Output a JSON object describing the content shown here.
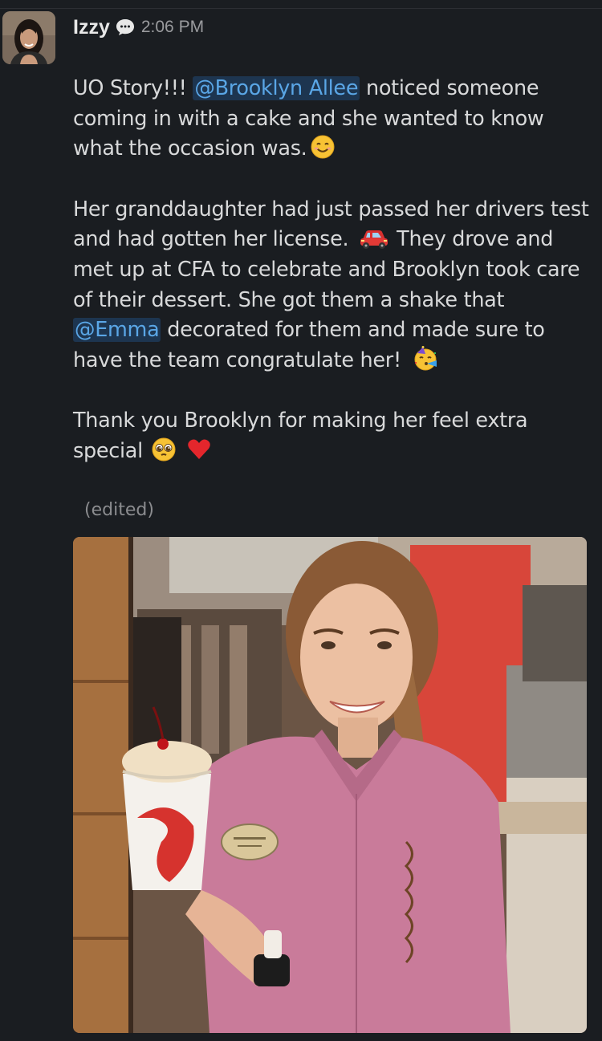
{
  "message": {
    "author": "Izzy",
    "time": "2:06 PM",
    "paragraph1": {
      "before": "UO Story!!! ",
      "mention": "@Brooklyn Allee",
      "after": " noticed someone coming in with a cake and she wanted to know what the occasion was."
    },
    "paragraph2": {
      "part1": "Her granddaughter had just passed her drivers test and had gotten her license.",
      "part2": " They drove and met up at CFA to celebrate and Brooklyn took care of their dessert. She got them a shake that ",
      "mention": "@Emma",
      "part3": " decorated for them and made sure to have the team congratulate her!"
    },
    "paragraph3": "Thank you Brooklyn for making her feel extra special",
    "edited": "(edited)"
  },
  "icons": {
    "status": "chat-bubble-icon",
    "emoji1": "smiling-face-emoji",
    "emoji2": "red-car-emoji",
    "emoji3": "partying-face-emoji",
    "emoji4": "pleading-face-emoji",
    "emoji5": "red-heart-emoji"
  },
  "colors": {
    "background": "#1a1d21",
    "mention_bg": "#1d3550",
    "mention_text": "#5aa6e6",
    "text": "#d8d9da",
    "muted": "#8b8c8f"
  }
}
